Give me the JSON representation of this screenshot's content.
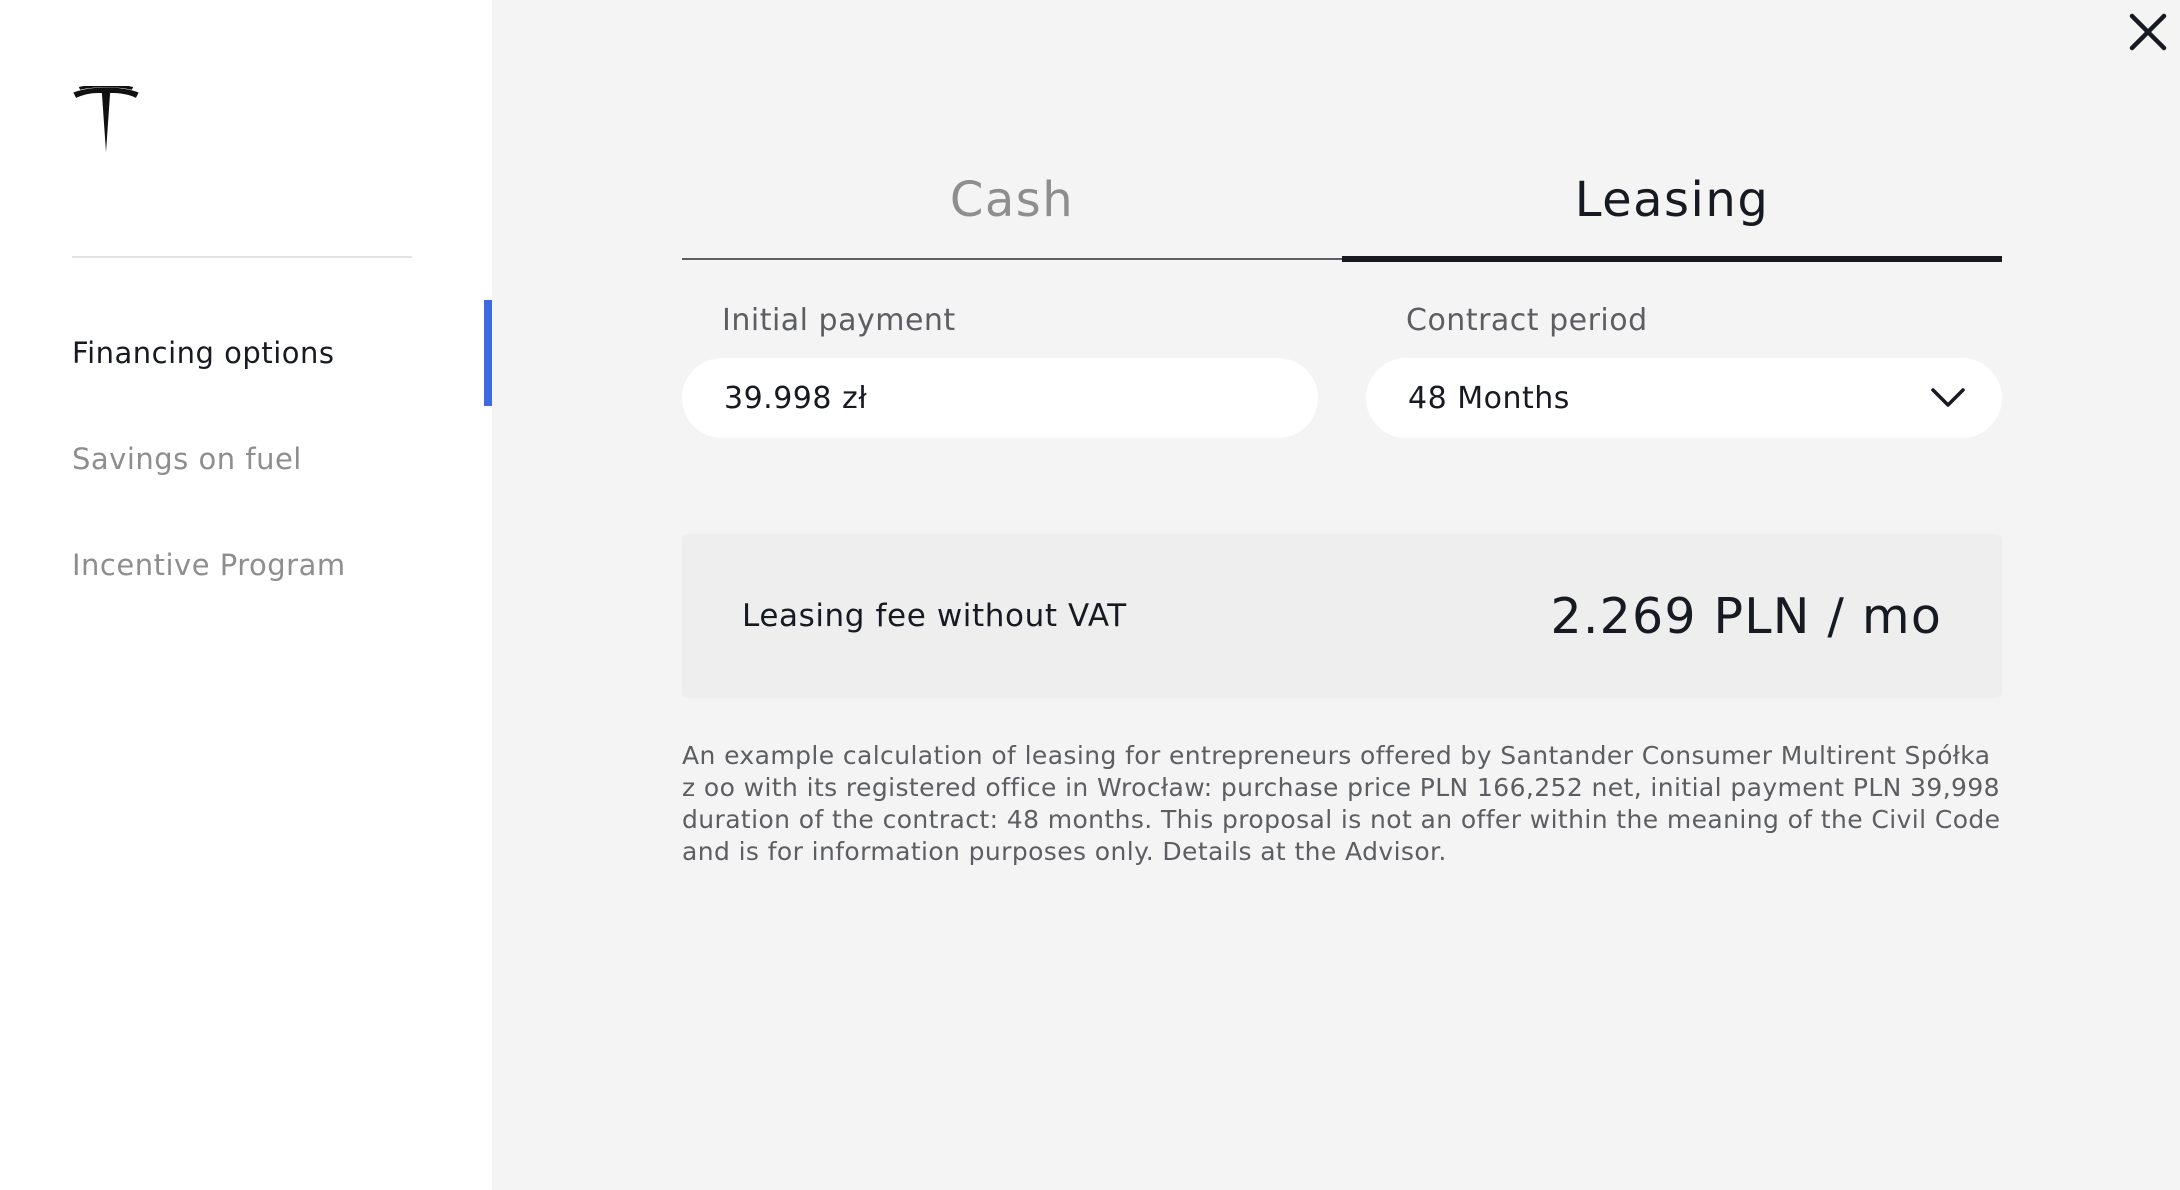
{
  "sidebar": {
    "logo": "tesla-logo",
    "items": [
      {
        "label": "Financing options",
        "active": true
      },
      {
        "label": "Savings on fuel",
        "active": false
      },
      {
        "label": "Incentive Program",
        "active": false
      }
    ],
    "active_indicator_color": "#3e6ae1"
  },
  "header": {
    "close_icon": "close-icon"
  },
  "tabs": [
    {
      "label": "Cash",
      "active": false
    },
    {
      "label": "Leasing",
      "active": true
    }
  ],
  "form": {
    "initial_payment": {
      "label": "Initial payment",
      "value": "39.998 zł"
    },
    "contract_period": {
      "label": "Contract period",
      "selected": "48 Months",
      "icon": "chevron-down-icon"
    }
  },
  "fee": {
    "label": "Leasing fee without VAT",
    "value": "2.269 PLN / mo"
  },
  "disclaimer": "An example calculation of leasing for entrepreneurs offered by Santander Consumer Multirent Spółka z oo with its registered office in Wrocław: purchase price PLN 166,252 net, initial payment PLN 39,998 duration of the contract: 48 months. This proposal is not an offer within the meaning of the Civil Code and is for information purposes only. Details at the Advisor.",
  "colors": {
    "panel_background": "#f4f4f4",
    "sidebar_background": "#ffffff",
    "text_primary": "#171a20",
    "text_muted": "#8e8e8e"
  }
}
